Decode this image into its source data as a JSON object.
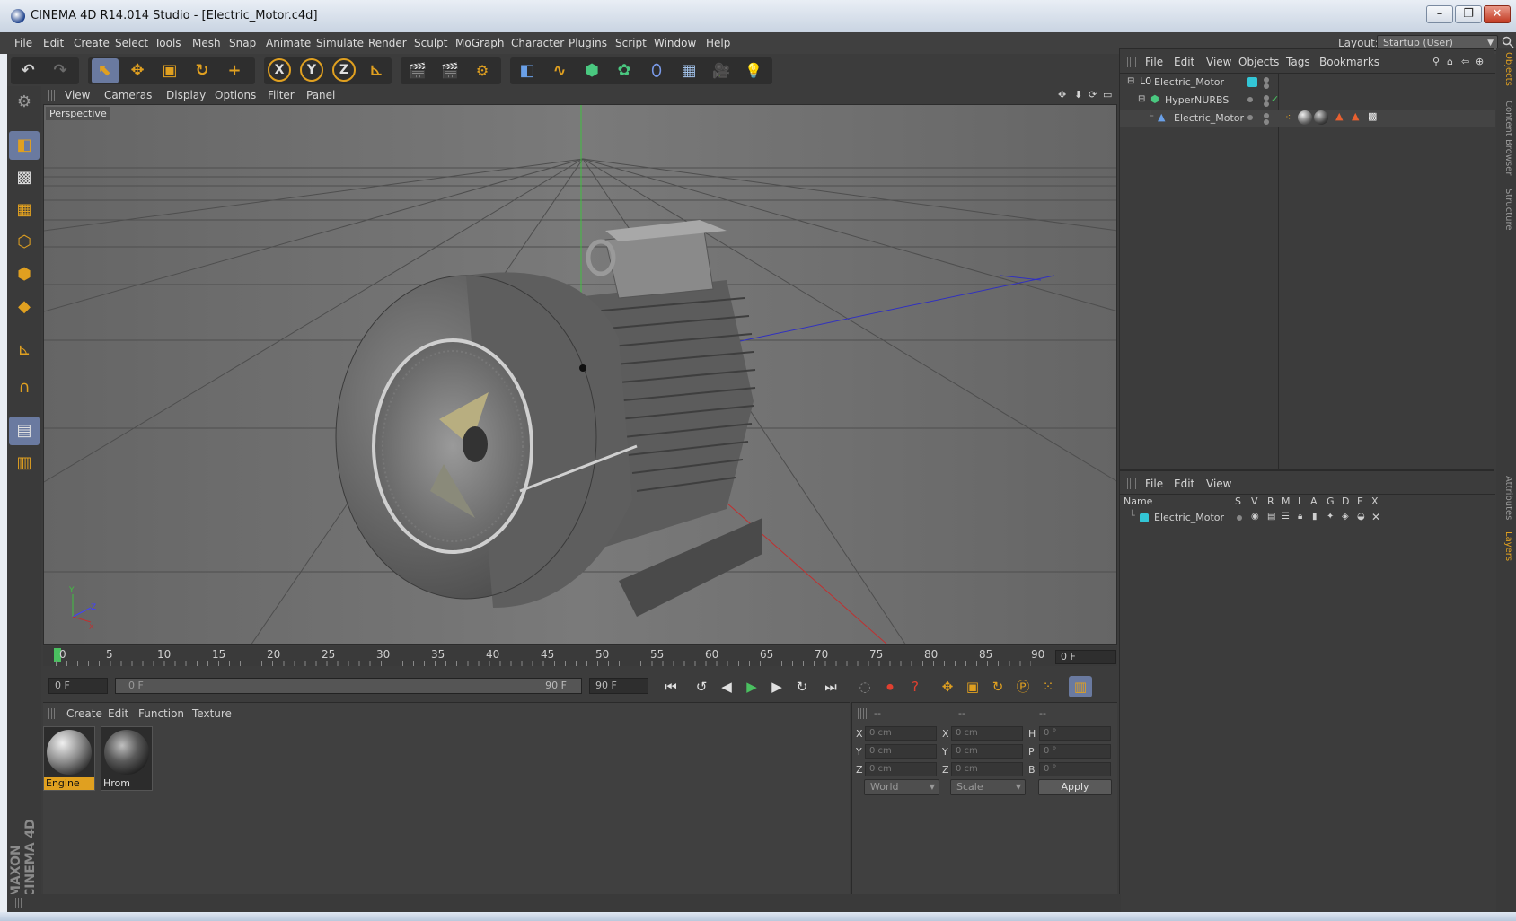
{
  "window": {
    "title": "CINEMA 4D R14.014 Studio - [Electric_Motor.c4d]",
    "controls": [
      "–",
      "❐",
      "✕"
    ]
  },
  "menubar": {
    "items": [
      "File",
      "Edit",
      "Create",
      "Select",
      "Tools",
      "Mesh",
      "Snap",
      "Animate",
      "Simulate",
      "Render",
      "Sculpt",
      "MoGraph",
      "Character",
      "Plugins",
      "Script",
      "Window",
      "Help"
    ],
    "layout_label": "Layout:",
    "layout_value": "Startup (User)"
  },
  "toolbar": {
    "undo": "↶",
    "redo": "↷",
    "select_icon": "⬉",
    "move_icon": "✥",
    "scale_icon": "▣",
    "rotate_icon": "↻",
    "add_icon": "+",
    "x_axis": "X",
    "y_axis": "Y",
    "z_axis": "Z",
    "coord_icon": "⊾",
    "render_view": "🎬",
    "render_pv": "🎬",
    "render_settings": "⚙",
    "cube_icon": "◧",
    "spline_icon": "∿",
    "nurbs_icon": "⬢",
    "array_icon": "✿",
    "deformer_icon": "⬯",
    "scene_icon": "▦",
    "camera_icon": "🎥",
    "light_icon": "💡"
  },
  "viewport": {
    "menu": [
      "View",
      "Cameras",
      "Display",
      "Options",
      "Filter",
      "Panel"
    ],
    "label": "Perspective",
    "axis_y": "Y",
    "axis_z": "Z",
    "axis_x": "X"
  },
  "timeline": {
    "ticks": [
      "0",
      "5",
      "10",
      "15",
      "20",
      "25",
      "30",
      "35",
      "40",
      "45",
      "50",
      "55",
      "60",
      "65",
      "70",
      "75",
      "80",
      "85",
      "90"
    ],
    "current_frame": "0 F",
    "start_field": "0 F",
    "range_start": "0 F",
    "range_end": "90 F",
    "end_field": "90 F"
  },
  "materials": {
    "menu": [
      "Create",
      "Edit",
      "Function",
      "Texture"
    ],
    "items": [
      {
        "name": "Engine"
      },
      {
        "name": "Hrom"
      }
    ]
  },
  "coordinates": {
    "headers": [
      "--",
      "--",
      "--"
    ],
    "rows": [
      {
        "l1": "X",
        "v1": "0 cm",
        "l2": "X",
        "v2": "0 cm",
        "l3": "H",
        "v3": "0 °"
      },
      {
        "l1": "Y",
        "v1": "0 cm",
        "l2": "Y",
        "v2": "0 cm",
        "l3": "P",
        "v3": "0 °"
      },
      {
        "l1": "Z",
        "v1": "0 cm",
        "l2": "Z",
        "v2": "0 cm",
        "l3": "B",
        "v3": "0 °"
      }
    ],
    "mode": "World",
    "type": "Scale",
    "apply": "Apply"
  },
  "objects": {
    "menu": [
      "File",
      "Edit",
      "View",
      "Objects",
      "Tags",
      "Bookmarks"
    ],
    "tree": [
      {
        "name": "Electric_Motor"
      },
      {
        "name": "HyperNURBS"
      },
      {
        "name": "Electric_Motor"
      }
    ]
  },
  "layers": {
    "menu": [
      "File",
      "Edit",
      "View"
    ],
    "headers": [
      "Name",
      "S",
      "V",
      "R",
      "M",
      "L",
      "A",
      "G",
      "D",
      "E",
      "X"
    ],
    "rows": [
      {
        "name": "Electric_Motor"
      }
    ]
  },
  "right_tabs": [
    "Objects",
    "Content Browser",
    "Structure",
    "Attributes",
    "Layers"
  ],
  "brand": "MAXON CINEMA 4D",
  "colors": {
    "accent": "#e0a020",
    "active_button": "#6a7aa0",
    "layer_color": "#33c6d6"
  }
}
